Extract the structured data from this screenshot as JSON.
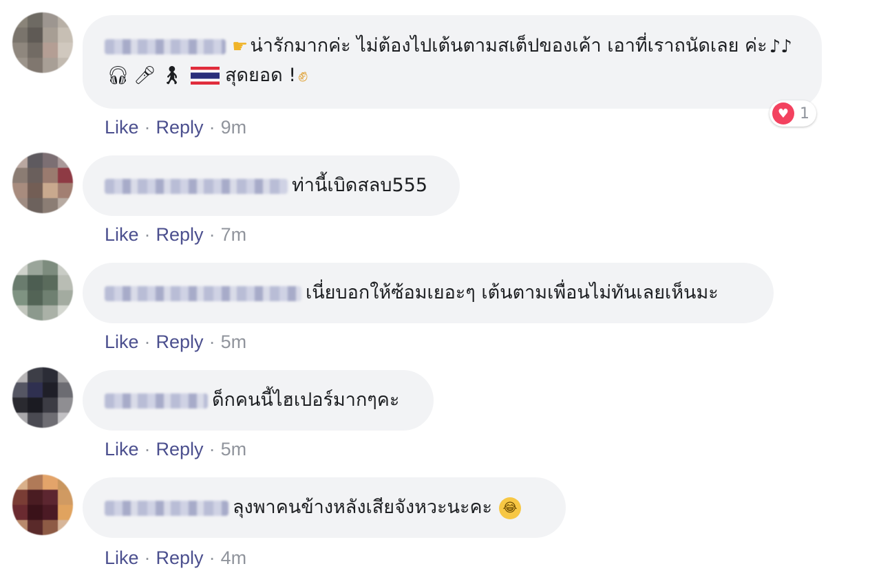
{
  "comments": [
    {
      "text": "น่ารักมากค่ะ ไม่ต้องไปเต้นตามสเต็ปของเค้า เอาที่เราถนัดเลย ค่ะ",
      "text_after": "สุดยอด !",
      "emojis": [
        "pointing-hand-icon",
        "music-notes-icon",
        "headphones-icon",
        "microphone-icon",
        "dancer-icon",
        "thai-flag-icon",
        "fist-icon"
      ],
      "like": "Like",
      "reply": "Reply",
      "time": "9m",
      "reaction": {
        "icon": "heart-icon",
        "count": "1",
        "color": "#f3425f"
      },
      "avatar_colors": [
        "#8a8479",
        "#6e6a63",
        "#9d9690",
        "#b8b0a6",
        "#7a746c",
        "#5f5a55",
        "#a79e94",
        "#c7bfb4",
        "#8f877e",
        "#726b64",
        "#b49e94",
        "#d0c8be",
        "#9c948b",
        "#80776f",
        "#a89f96",
        "#c2bab0"
      ]
    },
    {
      "text": "ท่านี้เบิดสลบ555",
      "like": "Like",
      "reply": "Reply",
      "time": "7m",
      "avatar_colors": [
        "#b9a7a0",
        "#5e5a5f",
        "#7c6f73",
        "#a99999",
        "#8b7c73",
        "#6a5f5c",
        "#9a7b6f",
        "#8e3a44",
        "#a88c7e",
        "#735e55",
        "#c9a98e",
        "#a27f72",
        "#9f8c82",
        "#6d625d",
        "#8b7d74",
        "#b7aaa1"
      ]
    },
    {
      "text": "เนี่ยบอกให้ซ้อมเยอะๆ เต้นตามเพื่อนไม่ทันเลยเห็นมะ",
      "like": "Like",
      "reply": "Reply",
      "time": "5m",
      "avatar_colors": [
        "#cfd2cb",
        "#9aa59a",
        "#7d8c7e",
        "#c9ccc5",
        "#6a7c6e",
        "#4d5e52",
        "#5a6b5c",
        "#b9bdb4",
        "#7f9382",
        "#536456",
        "#6f8071",
        "#a3aba0",
        "#c2c6bd",
        "#8c998d",
        "#aab1a7",
        "#d4d7d0"
      ]
    },
    {
      "text": "ด็กคนนี้ไฮเปอร์มากๆคะ",
      "like": "Like",
      "reply": "Reply",
      "time": "5m",
      "avatar_colors": [
        "#b7b5b6",
        "#3d3e47",
        "#2b2c36",
        "#9b9a9c",
        "#555663",
        "#2f3050",
        "#1f1f28",
        "#6c6c72",
        "#2a2a30",
        "#1b1b22",
        "#3c3c44",
        "#8f8e92",
        "#a9a8ab",
        "#4a4a52",
        "#6e6d73",
        "#c2c1c4"
      ]
    },
    {
      "text": "ลุงพาคนข้างหลังเสียจังหวะนะคะ",
      "emoji_end": "laughing-tears-icon",
      "like": "Like",
      "reply": "Reply",
      "time": "4m",
      "avatar_colors": [
        "#d9b08a",
        "#b07a58",
        "#e3a46a",
        "#c9965e",
        "#7a3d35",
        "#4a1c22",
        "#5c2630",
        "#d09a62",
        "#6a2a30",
        "#3a1219",
        "#4b1a24",
        "#e0a35f",
        "#b98a6c",
        "#5a2a2a",
        "#8e5b45",
        "#d7b699"
      ]
    }
  ]
}
